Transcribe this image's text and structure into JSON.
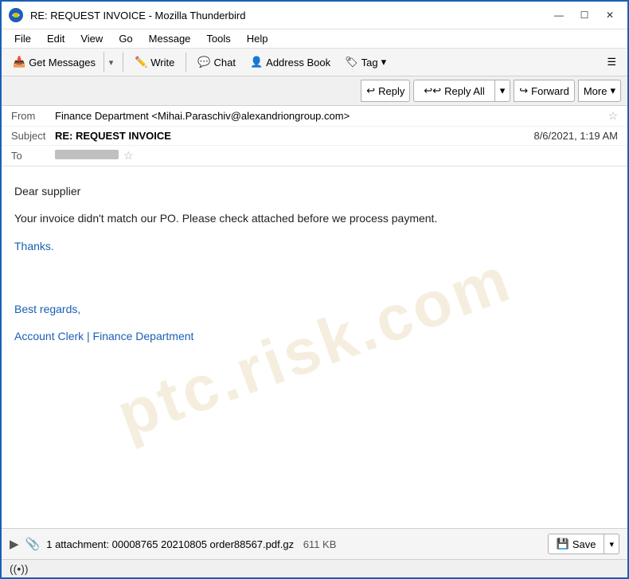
{
  "window": {
    "title": "RE: REQUEST INVOICE - Mozilla Thunderbird"
  },
  "titlebar": {
    "title": "RE: REQUEST INVOICE - Mozilla Thunderbird",
    "minimize_label": "—",
    "maximize_label": "☐",
    "close_label": "✕"
  },
  "menubar": {
    "items": [
      {
        "label": "File",
        "id": "file"
      },
      {
        "label": "Edit",
        "id": "edit"
      },
      {
        "label": "View",
        "id": "view"
      },
      {
        "label": "Go",
        "id": "go"
      },
      {
        "label": "Message",
        "id": "message"
      },
      {
        "label": "Tools",
        "id": "tools"
      },
      {
        "label": "Help",
        "id": "help"
      }
    ]
  },
  "toolbar": {
    "get_messages_label": "Get Messages",
    "write_label": "Write",
    "chat_label": "Chat",
    "address_book_label": "Address Book",
    "tag_label": "Tag",
    "menu_icon": "☰"
  },
  "action_toolbar": {
    "reply_label": "Reply",
    "reply_all_label": "Reply All",
    "forward_label": "Forward",
    "more_label": "More"
  },
  "email": {
    "from_label": "From",
    "from_value": "Finance Department <Mihai.Paraschiv@alexandriongroup.com>",
    "subject_label": "Subject",
    "subject_value": "RE: REQUEST INVOICE",
    "date_value": "8/6/2021, 1:19 AM",
    "to_label": "To",
    "body": {
      "greeting": "Dear supplier",
      "paragraph1": "Your invoice didn't match our PO. Please check attached before we process payment.",
      "thanks": "Thanks.",
      "best_regards": "Best regards,",
      "signature": "Account Clerk | Finance Department"
    }
  },
  "attachment": {
    "count_label": "1 attachment:",
    "filename": "00008765 20210805 order88567.pdf.gz",
    "size": "611 KB",
    "save_label": "Save"
  },
  "statusbar": {
    "wifi_icon": "((•))"
  },
  "watermark": "ptc.risk.com"
}
